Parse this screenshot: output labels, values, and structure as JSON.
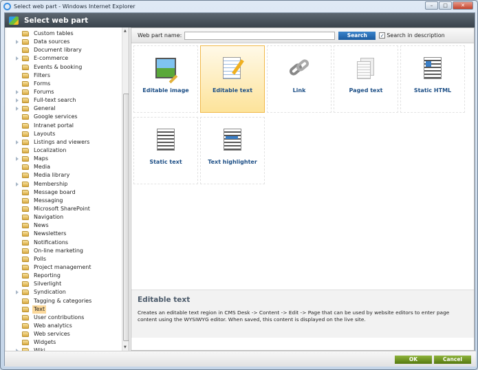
{
  "window": {
    "title": "Select web part - Windows Internet Explorer"
  },
  "header": {
    "title": "Select web part"
  },
  "tree": {
    "items": [
      {
        "label": "Custom tables",
        "expandable": false
      },
      {
        "label": "Data sources",
        "expandable": true
      },
      {
        "label": "Document library",
        "expandable": false
      },
      {
        "label": "E-commerce",
        "expandable": true
      },
      {
        "label": "Events & booking",
        "expandable": false
      },
      {
        "label": "Filters",
        "expandable": false
      },
      {
        "label": "Forms",
        "expandable": false
      },
      {
        "label": "Forums",
        "expandable": true
      },
      {
        "label": "Full-text search",
        "expandable": true
      },
      {
        "label": "General",
        "expandable": true
      },
      {
        "label": "Google services",
        "expandable": false
      },
      {
        "label": "Intranet portal",
        "expandable": false
      },
      {
        "label": "Layouts",
        "expandable": false
      },
      {
        "label": "Listings and viewers",
        "expandable": true
      },
      {
        "label": "Localization",
        "expandable": false
      },
      {
        "label": "Maps",
        "expandable": true
      },
      {
        "label": "Media",
        "expandable": false
      },
      {
        "label": "Media library",
        "expandable": false
      },
      {
        "label": "Membership",
        "expandable": true
      },
      {
        "label": "Message board",
        "expandable": false
      },
      {
        "label": "Messaging",
        "expandable": false
      },
      {
        "label": "Microsoft SharePoint",
        "expandable": false
      },
      {
        "label": "Navigation",
        "expandable": false
      },
      {
        "label": "News",
        "expandable": false
      },
      {
        "label": "Newsletters",
        "expandable": false
      },
      {
        "label": "Notifications",
        "expandable": false
      },
      {
        "label": "On-line marketing",
        "expandable": false
      },
      {
        "label": "Polls",
        "expandable": false
      },
      {
        "label": "Project management",
        "expandable": false
      },
      {
        "label": "Reporting",
        "expandable": false
      },
      {
        "label": "Silverlight",
        "expandable": false
      },
      {
        "label": "Syndication",
        "expandable": true
      },
      {
        "label": "Tagging & categories",
        "expandable": false
      },
      {
        "label": "Text",
        "expandable": false,
        "selected": true
      },
      {
        "label": "User contributions",
        "expandable": false
      },
      {
        "label": "Web analytics",
        "expandable": false
      },
      {
        "label": "Web services",
        "expandable": false
      },
      {
        "label": "Widgets",
        "expandable": false
      },
      {
        "label": "Wiki",
        "expandable": true
      }
    ]
  },
  "toolbar": {
    "name_label": "Web part name:",
    "name_value": "",
    "search_label": "Search",
    "search_in_description_label": "Search in description",
    "search_in_description_checked": true
  },
  "webparts": [
    {
      "label": "Editable image",
      "icon": "image-icon"
    },
    {
      "label": "Editable text",
      "icon": "notepad-pencil-icon",
      "selected": true
    },
    {
      "label": "Link",
      "icon": "chain-link-icon"
    },
    {
      "label": "Paged text",
      "icon": "pages-icon"
    },
    {
      "label": "Static HTML",
      "icon": "html-document-icon"
    },
    {
      "label": "Static text",
      "icon": "text-document-icon"
    },
    {
      "label": "Text highlighter",
      "icon": "highlighted-text-icon"
    }
  ],
  "description": {
    "title": "Editable text",
    "text": "Creates an editable text region in CMS Desk -> Content -> Edit -> Page that can be used by website editors to enter page content using the WYSIWYG editor. When saved, this content is displayed on the live site."
  },
  "footer": {
    "ok_label": "OK",
    "cancel_label": "Cancel"
  },
  "colors": {
    "header": "#3a434c",
    "link": "#1d4f86",
    "selected": "#fbd89a",
    "ok_button": "#6a8e1f",
    "search_button": "#1a5a9e"
  }
}
